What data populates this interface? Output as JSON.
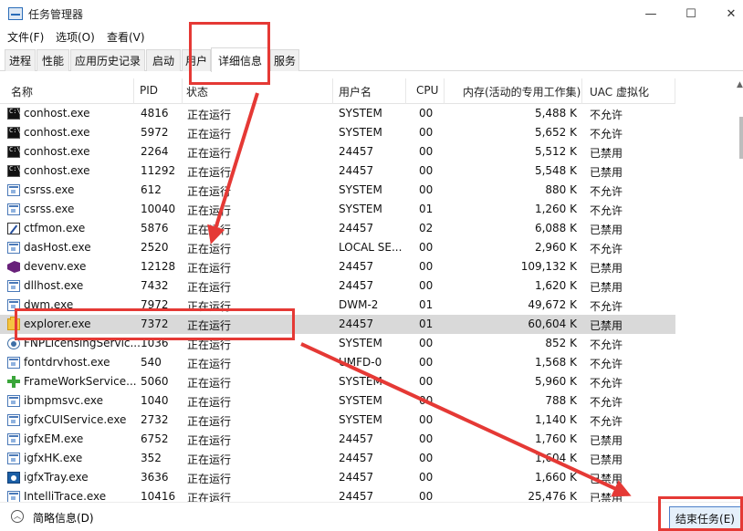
{
  "window": {
    "title": "任务管理器",
    "minimize": "—",
    "maximize": "☐",
    "close": "✕"
  },
  "menu": [
    "文件(F)",
    "选项(O)",
    "查看(V)"
  ],
  "tabs": [
    "进程",
    "性能",
    "应用历史记录",
    "启动",
    "用户",
    "详细信息",
    "服务"
  ],
  "active_tab": "详细信息",
  "columns": [
    "名称",
    "PID",
    "状态",
    "用户名",
    "CPU",
    "内存(活动的专用工作集)",
    "UAC 虚拟化"
  ],
  "sort_indicator": "^",
  "rows": [
    {
      "icon": "console-icon",
      "name": "conhost.exe",
      "pid": "4816",
      "status": "正在运行",
      "user": "SYSTEM",
      "cpu": "00",
      "mem": "5,488 K",
      "uac": "不允许"
    },
    {
      "icon": "console-icon",
      "name": "conhost.exe",
      "pid": "5972",
      "status": "正在运行",
      "user": "SYSTEM",
      "cpu": "00",
      "mem": "5,652 K",
      "uac": "不允许"
    },
    {
      "icon": "console-icon",
      "name": "conhost.exe",
      "pid": "2264",
      "status": "正在运行",
      "user": "24457",
      "cpu": "00",
      "mem": "5,512 K",
      "uac": "已禁用"
    },
    {
      "icon": "console-icon",
      "name": "conhost.exe",
      "pid": "11292",
      "status": "正在运行",
      "user": "24457",
      "cpu": "00",
      "mem": "5,548 K",
      "uac": "已禁用"
    },
    {
      "icon": "window-icon",
      "name": "csrss.exe",
      "pid": "612",
      "status": "正在运行",
      "user": "SYSTEM",
      "cpu": "00",
      "mem": "880 K",
      "uac": "不允许"
    },
    {
      "icon": "window-icon",
      "name": "csrss.exe",
      "pid": "10040",
      "status": "正在运行",
      "user": "SYSTEM",
      "cpu": "01",
      "mem": "1,260 K",
      "uac": "不允许"
    },
    {
      "icon": "pen-icon",
      "name": "ctfmon.exe",
      "pid": "5876",
      "status": "正在运行",
      "user": "24457",
      "cpu": "02",
      "mem": "6,088 K",
      "uac": "已禁用"
    },
    {
      "icon": "window-icon",
      "name": "dasHost.exe",
      "pid": "2520",
      "status": "正在运行",
      "user": "LOCAL SE...",
      "cpu": "00",
      "mem": "2,960 K",
      "uac": "不允许"
    },
    {
      "icon": "visual-studio-icon",
      "name": "devenv.exe",
      "pid": "12128",
      "status": "正在运行",
      "user": "24457",
      "cpu": "00",
      "mem": "109,132 K",
      "uac": "已禁用"
    },
    {
      "icon": "window-icon",
      "name": "dllhost.exe",
      "pid": "7432",
      "status": "正在运行",
      "user": "24457",
      "cpu": "00",
      "mem": "1,620 K",
      "uac": "已禁用"
    },
    {
      "icon": "window-icon",
      "name": "dwm.exe",
      "pid": "7972",
      "status": "正在运行",
      "user": "DWM-2",
      "cpu": "01",
      "mem": "49,672 K",
      "uac": "不允许"
    },
    {
      "icon": "folder-icon",
      "name": "explorer.exe",
      "pid": "7372",
      "status": "正在运行",
      "user": "24457",
      "cpu": "01",
      "mem": "60,604 K",
      "uac": "已禁用",
      "selected": true
    },
    {
      "icon": "disc-icon",
      "name": "FNPLicensingServic...",
      "pid": "1036",
      "status": "正在运行",
      "user": "SYSTEM",
      "cpu": "00",
      "mem": "852 K",
      "uac": "不允许"
    },
    {
      "icon": "window-icon",
      "name": "fontdrvhost.exe",
      "pid": "540",
      "status": "正在运行",
      "user": "UMFD-0",
      "cpu": "00",
      "mem": "1,568 K",
      "uac": "不允许"
    },
    {
      "icon": "plus-icon",
      "name": "FrameWorkService...",
      "pid": "5060",
      "status": "正在运行",
      "user": "SYSTEM",
      "cpu": "00",
      "mem": "5,960 K",
      "uac": "不允许"
    },
    {
      "icon": "window-icon",
      "name": "ibmpmsvc.exe",
      "pid": "1040",
      "status": "正在运行",
      "user": "SYSTEM",
      "cpu": "00",
      "mem": "788 K",
      "uac": "不允许"
    },
    {
      "icon": "window-icon",
      "name": "igfxCUIService.exe",
      "pid": "2732",
      "status": "正在运行",
      "user": "SYSTEM",
      "cpu": "00",
      "mem": "1,140 K",
      "uac": "不允许"
    },
    {
      "icon": "window-icon",
      "name": "igfxEM.exe",
      "pid": "6752",
      "status": "正在运行",
      "user": "24457",
      "cpu": "00",
      "mem": "1,760 K",
      "uac": "已禁用"
    },
    {
      "icon": "window-icon",
      "name": "igfxHK.exe",
      "pid": "352",
      "status": "正在运行",
      "user": "24457",
      "cpu": "00",
      "mem": "1,604 K",
      "uac": "已禁用"
    },
    {
      "icon": "intel-icon",
      "name": "igfxTray.exe",
      "pid": "3636",
      "status": "正在运行",
      "user": "24457",
      "cpu": "00",
      "mem": "1,660 K",
      "uac": "已禁用"
    },
    {
      "icon": "window-icon",
      "name": "IntelliTrace.exe",
      "pid": "10416",
      "status": "正在运行",
      "user": "24457",
      "cpu": "00",
      "mem": "25,476 K",
      "uac": "已禁用"
    }
  ],
  "footer": {
    "collapse_label": "简略信息(D)",
    "end_task_label": "结束任务(E)"
  },
  "annotation_color": "#e53935"
}
